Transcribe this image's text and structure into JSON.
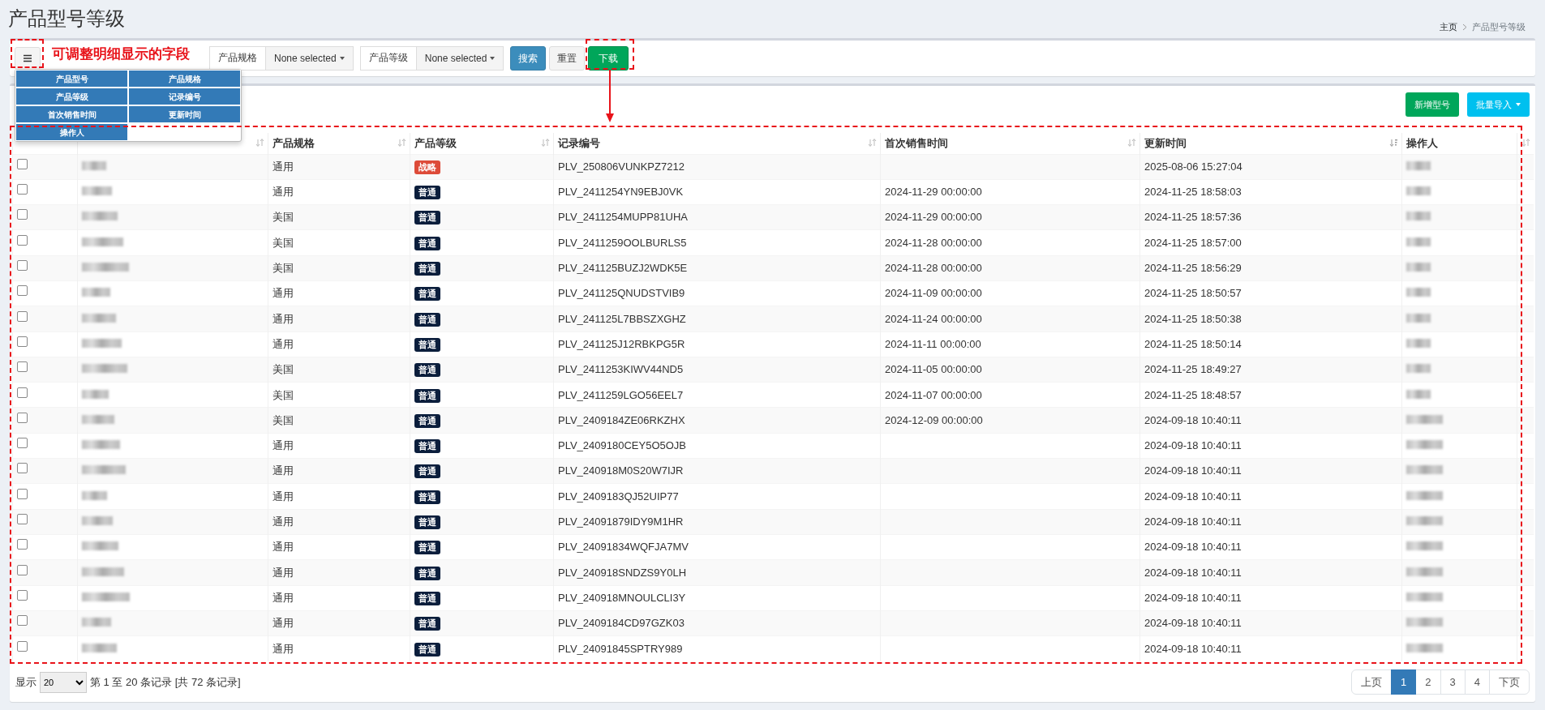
{
  "page_title": "产品型号等级",
  "breadcrumb": [
    {
      "label": "主页"
    },
    {
      "label": "产品型号等级"
    }
  ],
  "toolbar": {
    "filters": [
      {
        "label": "产品规格",
        "value": "None selected"
      },
      {
        "label": "产品等级",
        "value": "None selected"
      }
    ],
    "buttons": [
      {
        "label": "搜索",
        "kind": "primary"
      },
      {
        "label": "重置",
        "kind": "default"
      },
      {
        "label": "下载",
        "kind": "success"
      }
    ]
  },
  "annotation": {
    "text": "可调整明细显示的字段"
  },
  "column_menu": {
    "items": [
      {
        "label": "产品型号",
        "selected": true
      },
      {
        "label": "产品规格",
        "selected": true
      },
      {
        "label": "产品等级",
        "selected": true
      },
      {
        "label": "记录编号",
        "selected": true
      },
      {
        "label": "首次销售时间",
        "selected": true
      },
      {
        "label": "更新时间",
        "selected": true
      },
      {
        "label": "操作人",
        "selected": true
      }
    ]
  },
  "actions": [
    {
      "label": "新增型号",
      "kind": "success",
      "caret": false
    },
    {
      "label": "批量导入",
      "kind": "info",
      "caret": true
    }
  ],
  "table": {
    "columns": [
      {
        "kind": "check"
      },
      {
        "kind": "model",
        "sorted": false
      },
      {
        "kind": "spec",
        "label": "产品规格",
        "sorted": false
      },
      {
        "kind": "level",
        "label": "产品等级",
        "sorted": false
      },
      {
        "kind": "record",
        "label": "记录编号",
        "sorted": false
      },
      {
        "kind": "first",
        "label": "首次销售时间",
        "sorted": false
      },
      {
        "kind": "updated",
        "label": "更新时间",
        "sorted": true
      },
      {
        "kind": "operator",
        "label": "操作人"
      },
      {
        "kind": "extra",
        "sorted": false
      }
    ],
    "rows": [
      {
        "checked": false,
        "spec": "通用",
        "level": {
          "label": "战略",
          "color": "#dd4b39"
        },
        "record": "PLV_250806VUNKPZ7212",
        "updated": "2025-08-06 15:27:04"
      },
      {
        "checked": false,
        "spec": "通用",
        "level": {
          "label": "普通",
          "color": "#0b1e3c"
        },
        "record": "PLV_2411254YN9EBJ0VK",
        "first": "2024-11-29 00:00:00",
        "updated": "2024-11-25 18:58:03"
      },
      {
        "checked": false,
        "spec": "美国",
        "level": {
          "label": "普通",
          "color": "#0b1e3c"
        },
        "record": "PLV_2411254MUPP81UHA",
        "first": "2024-11-29 00:00:00",
        "updated": "2024-11-25 18:57:36"
      },
      {
        "checked": false,
        "spec": "美国",
        "level": {
          "label": "普通",
          "color": "#0b1e3c"
        },
        "record": "PLV_2411259OOLBURLS5",
        "first": "2024-11-28 00:00:00",
        "updated": "2024-11-25 18:57:00"
      },
      {
        "checked": false,
        "spec": "美国",
        "level": {
          "label": "普通",
          "color": "#0b1e3c"
        },
        "record": "PLV_241125BUZJ2WDK5E",
        "first": "2024-11-28 00:00:00",
        "updated": "2024-11-25 18:56:29"
      },
      {
        "checked": false,
        "spec": "通用",
        "level": {
          "label": "普通",
          "color": "#0b1e3c"
        },
        "record": "PLV_241125QNUDSTVIB9",
        "first": "2024-11-09 00:00:00",
        "updated": "2024-11-25 18:50:57"
      },
      {
        "checked": false,
        "spec": "通用",
        "level": {
          "label": "普通",
          "color": "#0b1e3c"
        },
        "record": "PLV_241125L7BBSZXGHZ",
        "first": "2024-11-24 00:00:00",
        "updated": "2024-11-25 18:50:38"
      },
      {
        "checked": false,
        "spec": "通用",
        "level": {
          "label": "普通",
          "color": "#0b1e3c"
        },
        "record": "PLV_241125J12RBKPG5R",
        "first": "2024-11-11 00:00:00",
        "updated": "2024-11-25 18:50:14"
      },
      {
        "checked": false,
        "spec": "美国",
        "level": {
          "label": "普通",
          "color": "#0b1e3c"
        },
        "record": "PLV_2411253KIWV44ND5",
        "first": "2024-11-05 00:00:00",
        "updated": "2024-11-25 18:49:27"
      },
      {
        "checked": false,
        "spec": "美国",
        "level": {
          "label": "普通",
          "color": "#0b1e3c"
        },
        "record": "PLV_2411259LGO56EEL7",
        "first": "2024-11-07 00:00:00",
        "updated": "2024-11-25 18:48:57"
      },
      {
        "checked": false,
        "spec": "美国",
        "level": {
          "label": "普通",
          "color": "#0b1e3c"
        },
        "record": "PLV_2409184ZE06RKZHX",
        "first": "2024-12-09 00:00:00",
        "updated": "2024-09-18 10:40:11"
      },
      {
        "checked": false,
        "spec": "通用",
        "level": {
          "label": "普通",
          "color": "#0b1e3c"
        },
        "record": "PLV_2409180CEY5O5OJB",
        "updated": "2024-09-18 10:40:11"
      },
      {
        "checked": false,
        "spec": "通用",
        "level": {
          "label": "普通",
          "color": "#0b1e3c"
        },
        "record": "PLV_240918M0S20W7IJR",
        "updated": "2024-09-18 10:40:11"
      },
      {
        "checked": false,
        "spec": "通用",
        "level": {
          "label": "普通",
          "color": "#0b1e3c"
        },
        "record": "PLV_2409183QJ52UIP77",
        "updated": "2024-09-18 10:40:11"
      },
      {
        "checked": false,
        "spec": "通用",
        "level": {
          "label": "普通",
          "color": "#0b1e3c"
        },
        "record": "PLV_24091879IDY9M1HR",
        "updated": "2024-09-18 10:40:11"
      },
      {
        "checked": false,
        "spec": "通用",
        "level": {
          "label": "普通",
          "color": "#0b1e3c"
        },
        "record": "PLV_24091834WQFJA7MV",
        "updated": "2024-09-18 10:40:11"
      },
      {
        "checked": false,
        "spec": "通用",
        "level": {
          "label": "普通",
          "color": "#0b1e3c"
        },
        "record": "PLV_240918SNDZS9Y0LH",
        "updated": "2024-09-18 10:40:11"
      },
      {
        "checked": false,
        "spec": "通用",
        "level": {
          "label": "普通",
          "color": "#0b1e3c"
        },
        "record": "PLV_240918MNOULCLI3Y",
        "updated": "2024-09-18 10:40:11"
      },
      {
        "checked": false,
        "spec": "通用",
        "level": {
          "label": "普通",
          "color": "#0b1e3c"
        },
        "record": "PLV_2409184CD97GZK03",
        "updated": "2024-09-18 10:40:11"
      },
      {
        "checked": false,
        "spec": "通用",
        "level": {
          "label": "普通",
          "color": "#0b1e3c"
        },
        "record": "PLV_24091845SPTRY989",
        "updated": "2024-09-18 10:40:11"
      }
    ]
  },
  "footer": {
    "show_label": "显示",
    "page_size": "20",
    "info": "第 1 至 20 条记录 [共 72 条记录]"
  },
  "pagination": [
    {
      "label": "上页",
      "selected": false
    },
    {
      "label": "1",
      "selected": true
    },
    {
      "label": "2",
      "selected": false
    },
    {
      "label": "3",
      "selected": false
    },
    {
      "label": "4",
      "selected": false
    },
    {
      "label": "下页",
      "selected": false
    }
  ]
}
